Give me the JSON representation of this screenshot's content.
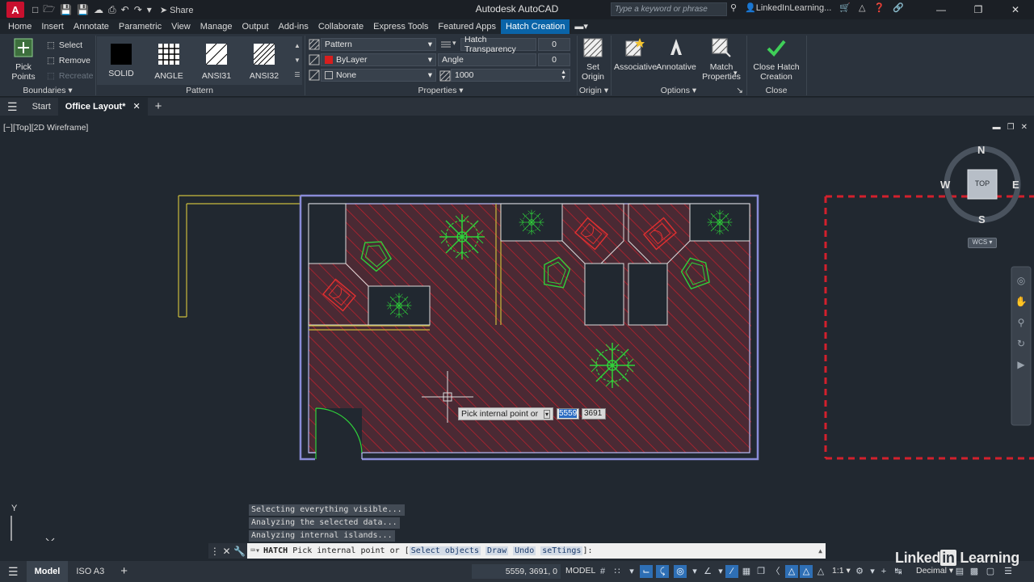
{
  "titlebar": {
    "app_letter": "A",
    "app_title": "Autodesk AutoCAD",
    "share_label": "Share",
    "search_placeholder": "Type a keyword or phrase",
    "user": "LinkedInLearning..."
  },
  "ribbon_tabs": [
    "Home",
    "Insert",
    "Annotate",
    "Parametric",
    "View",
    "Manage",
    "Output",
    "Add-ins",
    "Collaborate",
    "Express Tools",
    "Featured Apps",
    "Hatch Creation"
  ],
  "active_tab": "Hatch Creation",
  "boundaries": {
    "pick_points": "Pick Points",
    "select": "Select",
    "remove": "Remove",
    "recreate": "Recreate",
    "title": "Boundaries"
  },
  "pattern": {
    "swatches": [
      "SOLID",
      "ANGLE",
      "ANSI31",
      "ANSI32"
    ],
    "title": "Pattern"
  },
  "properties": {
    "type": "Pattern",
    "color": "ByLayer",
    "background": "None",
    "transparency_label": "Hatch Transparency",
    "transparency_value": "0",
    "angle_label": "Angle",
    "angle_value": "0",
    "scale_value": "1000",
    "title": "Properties"
  },
  "origin": {
    "set_origin": "Set Origin",
    "title": "Origin"
  },
  "options": {
    "associative": "Associative",
    "annotative": "Annotative",
    "match_properties": "Match Properties",
    "title": "Options"
  },
  "close": {
    "close_hatch": "Close Hatch Creation",
    "title": "Close"
  },
  "doc_tabs": {
    "start": "Start",
    "active": "Office Layout*"
  },
  "viewport_label": "[−][Top][2D Wireframe]",
  "viewcube": {
    "n": "N",
    "s": "S",
    "e": "E",
    "w": "W",
    "top": "TOP",
    "wcs": "WCS"
  },
  "dynamic_input": {
    "prompt": "Pick internal point or",
    "x": "5559",
    "y": "3691"
  },
  "command_history": [
    "Selecting everything visible...",
    "Analyzing the selected data...",
    "Analyzing internal islands..."
  ],
  "command_line": {
    "command": "HATCH",
    "prompt": "Pick internal point or [",
    "options": [
      "Select objects",
      "Draw",
      "Undo",
      "seTtings"
    ],
    "suffix": "]:"
  },
  "ucs": {
    "x": "X",
    "y": "Y"
  },
  "status": {
    "model_tab": "Model",
    "layout_tab": "ISO A3",
    "coordinates": "5559, 3691, 0",
    "space": "MODEL",
    "scale": "1:1",
    "units": "Decimal"
  },
  "watermark": {
    "brand": "Linked",
    "in": "in",
    "suffix": " Learning"
  },
  "colors": {
    "accent": "#0a64a8",
    "hatch": "#c8202c",
    "walls": "#8a8cd8",
    "plants": "#2fd13a",
    "chairs": "#e23030"
  }
}
